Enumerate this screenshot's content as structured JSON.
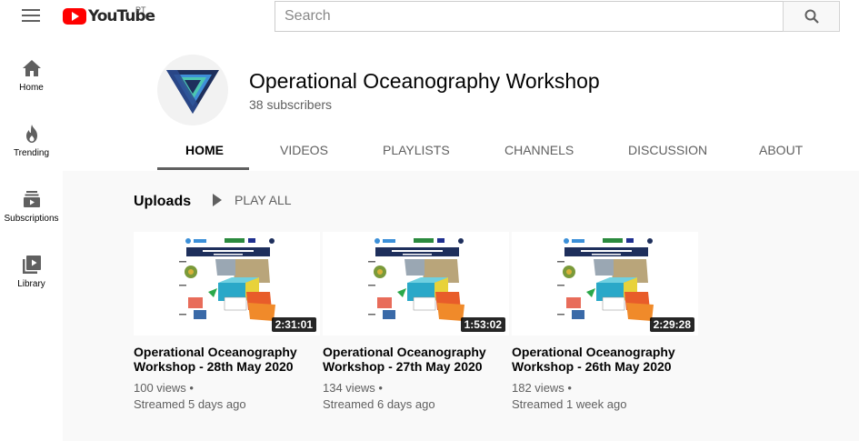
{
  "header": {
    "logo_text": "YouTube",
    "region": "PT",
    "search_placeholder": "Search"
  },
  "sidebar": {
    "items": [
      {
        "label": "Home",
        "icon": "home-icon"
      },
      {
        "label": "Trending",
        "icon": "flame-icon"
      },
      {
        "label": "Subscriptions",
        "icon": "subscriptions-icon"
      },
      {
        "label": "Library",
        "icon": "library-icon"
      }
    ]
  },
  "channel": {
    "name": "Operational Oceanography Workshop",
    "subscribers": "38 subscribers",
    "tabs": [
      "HOME",
      "VIDEOS",
      "PLAYLISTS",
      "CHANNELS",
      "DISCUSSION",
      "ABOUT"
    ],
    "active_tab": "HOME"
  },
  "uploads": {
    "title": "Uploads",
    "play_all": "PLAY ALL",
    "videos": [
      {
        "title_line1": "Operational Oceanography",
        "title_line2": "Workshop - 28th May 2020",
        "duration": "2:31:01",
        "views": "100 views •",
        "streamed": "Streamed 5 days ago"
      },
      {
        "title_line1": "Operational Oceanography",
        "title_line2": "Workshop - 27th May 2020",
        "duration": "1:53:02",
        "views": "134 views •",
        "streamed": "Streamed 6 days ago"
      },
      {
        "title_line1": "Operational Oceanography",
        "title_line2": "Workshop - 26th May 2020",
        "duration": "2:29:28",
        "views": "182 views •",
        "streamed": "Streamed 1 week ago"
      }
    ]
  },
  "colors": {
    "brand_red": "#ff0000",
    "text_primary": "#030303",
    "text_secondary": "#606060",
    "page_bg": "#f9f9f9"
  }
}
